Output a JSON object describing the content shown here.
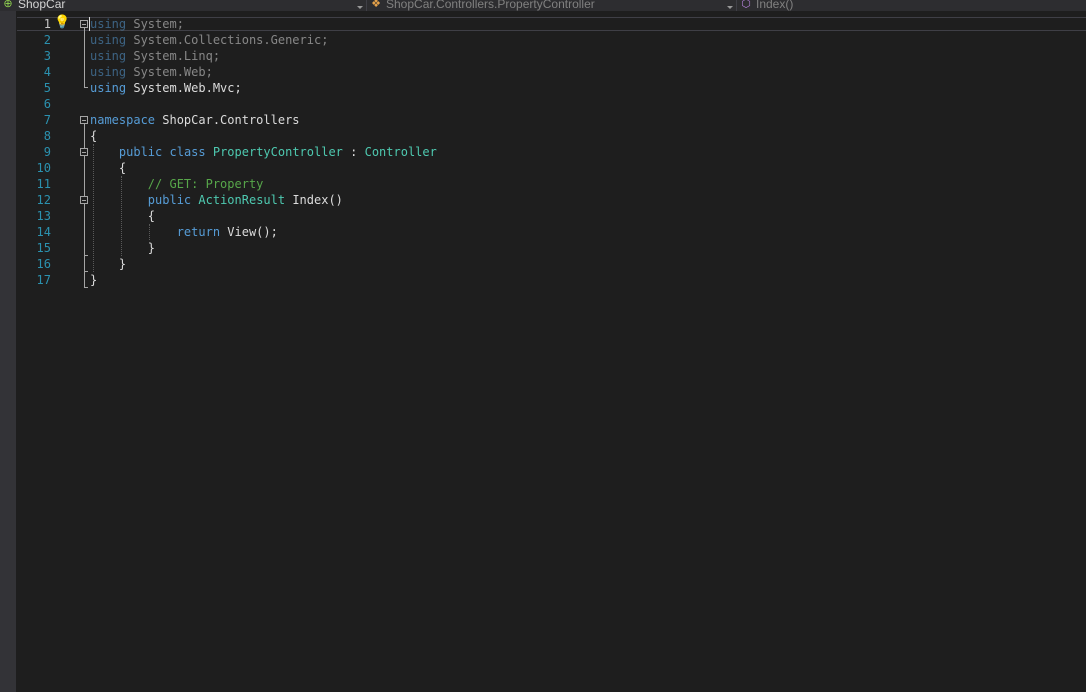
{
  "navbar": {
    "project": {
      "label": "ShopCar",
      "icon": "csharp-project-icon"
    },
    "class": {
      "label": "ShopCar.Controllers.PropertyController",
      "icon": "class-icon"
    },
    "member": {
      "label": "Index()",
      "icon": "method-icon"
    }
  },
  "editor": {
    "current_line": 1,
    "lines": [
      {
        "n": "1",
        "tokens": [
          {
            "t": "using",
            "c": "kw dim"
          },
          {
            "t": " System;",
            "c": "dim"
          }
        ]
      },
      {
        "n": "2",
        "tokens": [
          {
            "t": "using",
            "c": "kw dim"
          },
          {
            "t": " System.Collections.Generic;",
            "c": "dim"
          }
        ]
      },
      {
        "n": "3",
        "tokens": [
          {
            "t": "using",
            "c": "kw dim"
          },
          {
            "t": " System.Linq;",
            "c": "dim"
          }
        ]
      },
      {
        "n": "4",
        "tokens": [
          {
            "t": "using",
            "c": "kw dim"
          },
          {
            "t": " System.Web;",
            "c": "dim"
          }
        ]
      },
      {
        "n": "5",
        "tokens": [
          {
            "t": "using",
            "c": "kw"
          },
          {
            "t": " System.Web.Mvc;",
            "c": ""
          }
        ]
      },
      {
        "n": "6",
        "tokens": []
      },
      {
        "n": "7",
        "tokens": [
          {
            "t": "namespace",
            "c": "kw"
          },
          {
            "t": " ShopCar.Controllers",
            "c": ""
          }
        ]
      },
      {
        "n": "8",
        "tokens": [
          {
            "t": "{",
            "c": ""
          }
        ]
      },
      {
        "n": "9",
        "tokens": [
          {
            "t": "    ",
            "c": ""
          },
          {
            "t": "public",
            "c": "kw"
          },
          {
            "t": " ",
            "c": ""
          },
          {
            "t": "class",
            "c": "kw"
          },
          {
            "t": " ",
            "c": ""
          },
          {
            "t": "PropertyController",
            "c": "type"
          },
          {
            "t": " : ",
            "c": ""
          },
          {
            "t": "Controller",
            "c": "type"
          }
        ]
      },
      {
        "n": "10",
        "tokens": [
          {
            "t": "    {",
            "c": ""
          }
        ]
      },
      {
        "n": "11",
        "tokens": [
          {
            "t": "        ",
            "c": ""
          },
          {
            "t": "// GET: Property",
            "c": "comment"
          }
        ]
      },
      {
        "n": "12",
        "tokens": [
          {
            "t": "        ",
            "c": ""
          },
          {
            "t": "public",
            "c": "kw"
          },
          {
            "t": " ",
            "c": ""
          },
          {
            "t": "ActionResult",
            "c": "type"
          },
          {
            "t": " Index()",
            "c": ""
          }
        ]
      },
      {
        "n": "13",
        "tokens": [
          {
            "t": "        {",
            "c": ""
          }
        ]
      },
      {
        "n": "14",
        "tokens": [
          {
            "t": "            ",
            "c": ""
          },
          {
            "t": "return",
            "c": "kw"
          },
          {
            "t": " View();",
            "c": ""
          }
        ]
      },
      {
        "n": "15",
        "tokens": [
          {
            "t": "        }",
            "c": ""
          }
        ]
      },
      {
        "n": "16",
        "tokens": [
          {
            "t": "    }",
            "c": ""
          }
        ]
      },
      {
        "n": "17",
        "tokens": [
          {
            "t": "}",
            "c": ""
          }
        ]
      }
    ]
  },
  "icons": {
    "quick_action": "lightbulb-icon",
    "folding": "collapse-minus-icon"
  },
  "colors": {
    "background": "#1e1e1e",
    "keyword": "#569cd6",
    "type": "#4ec9b0",
    "comment": "#57a64a",
    "line_number": "#2b91af",
    "text": "#dcdcdc"
  }
}
